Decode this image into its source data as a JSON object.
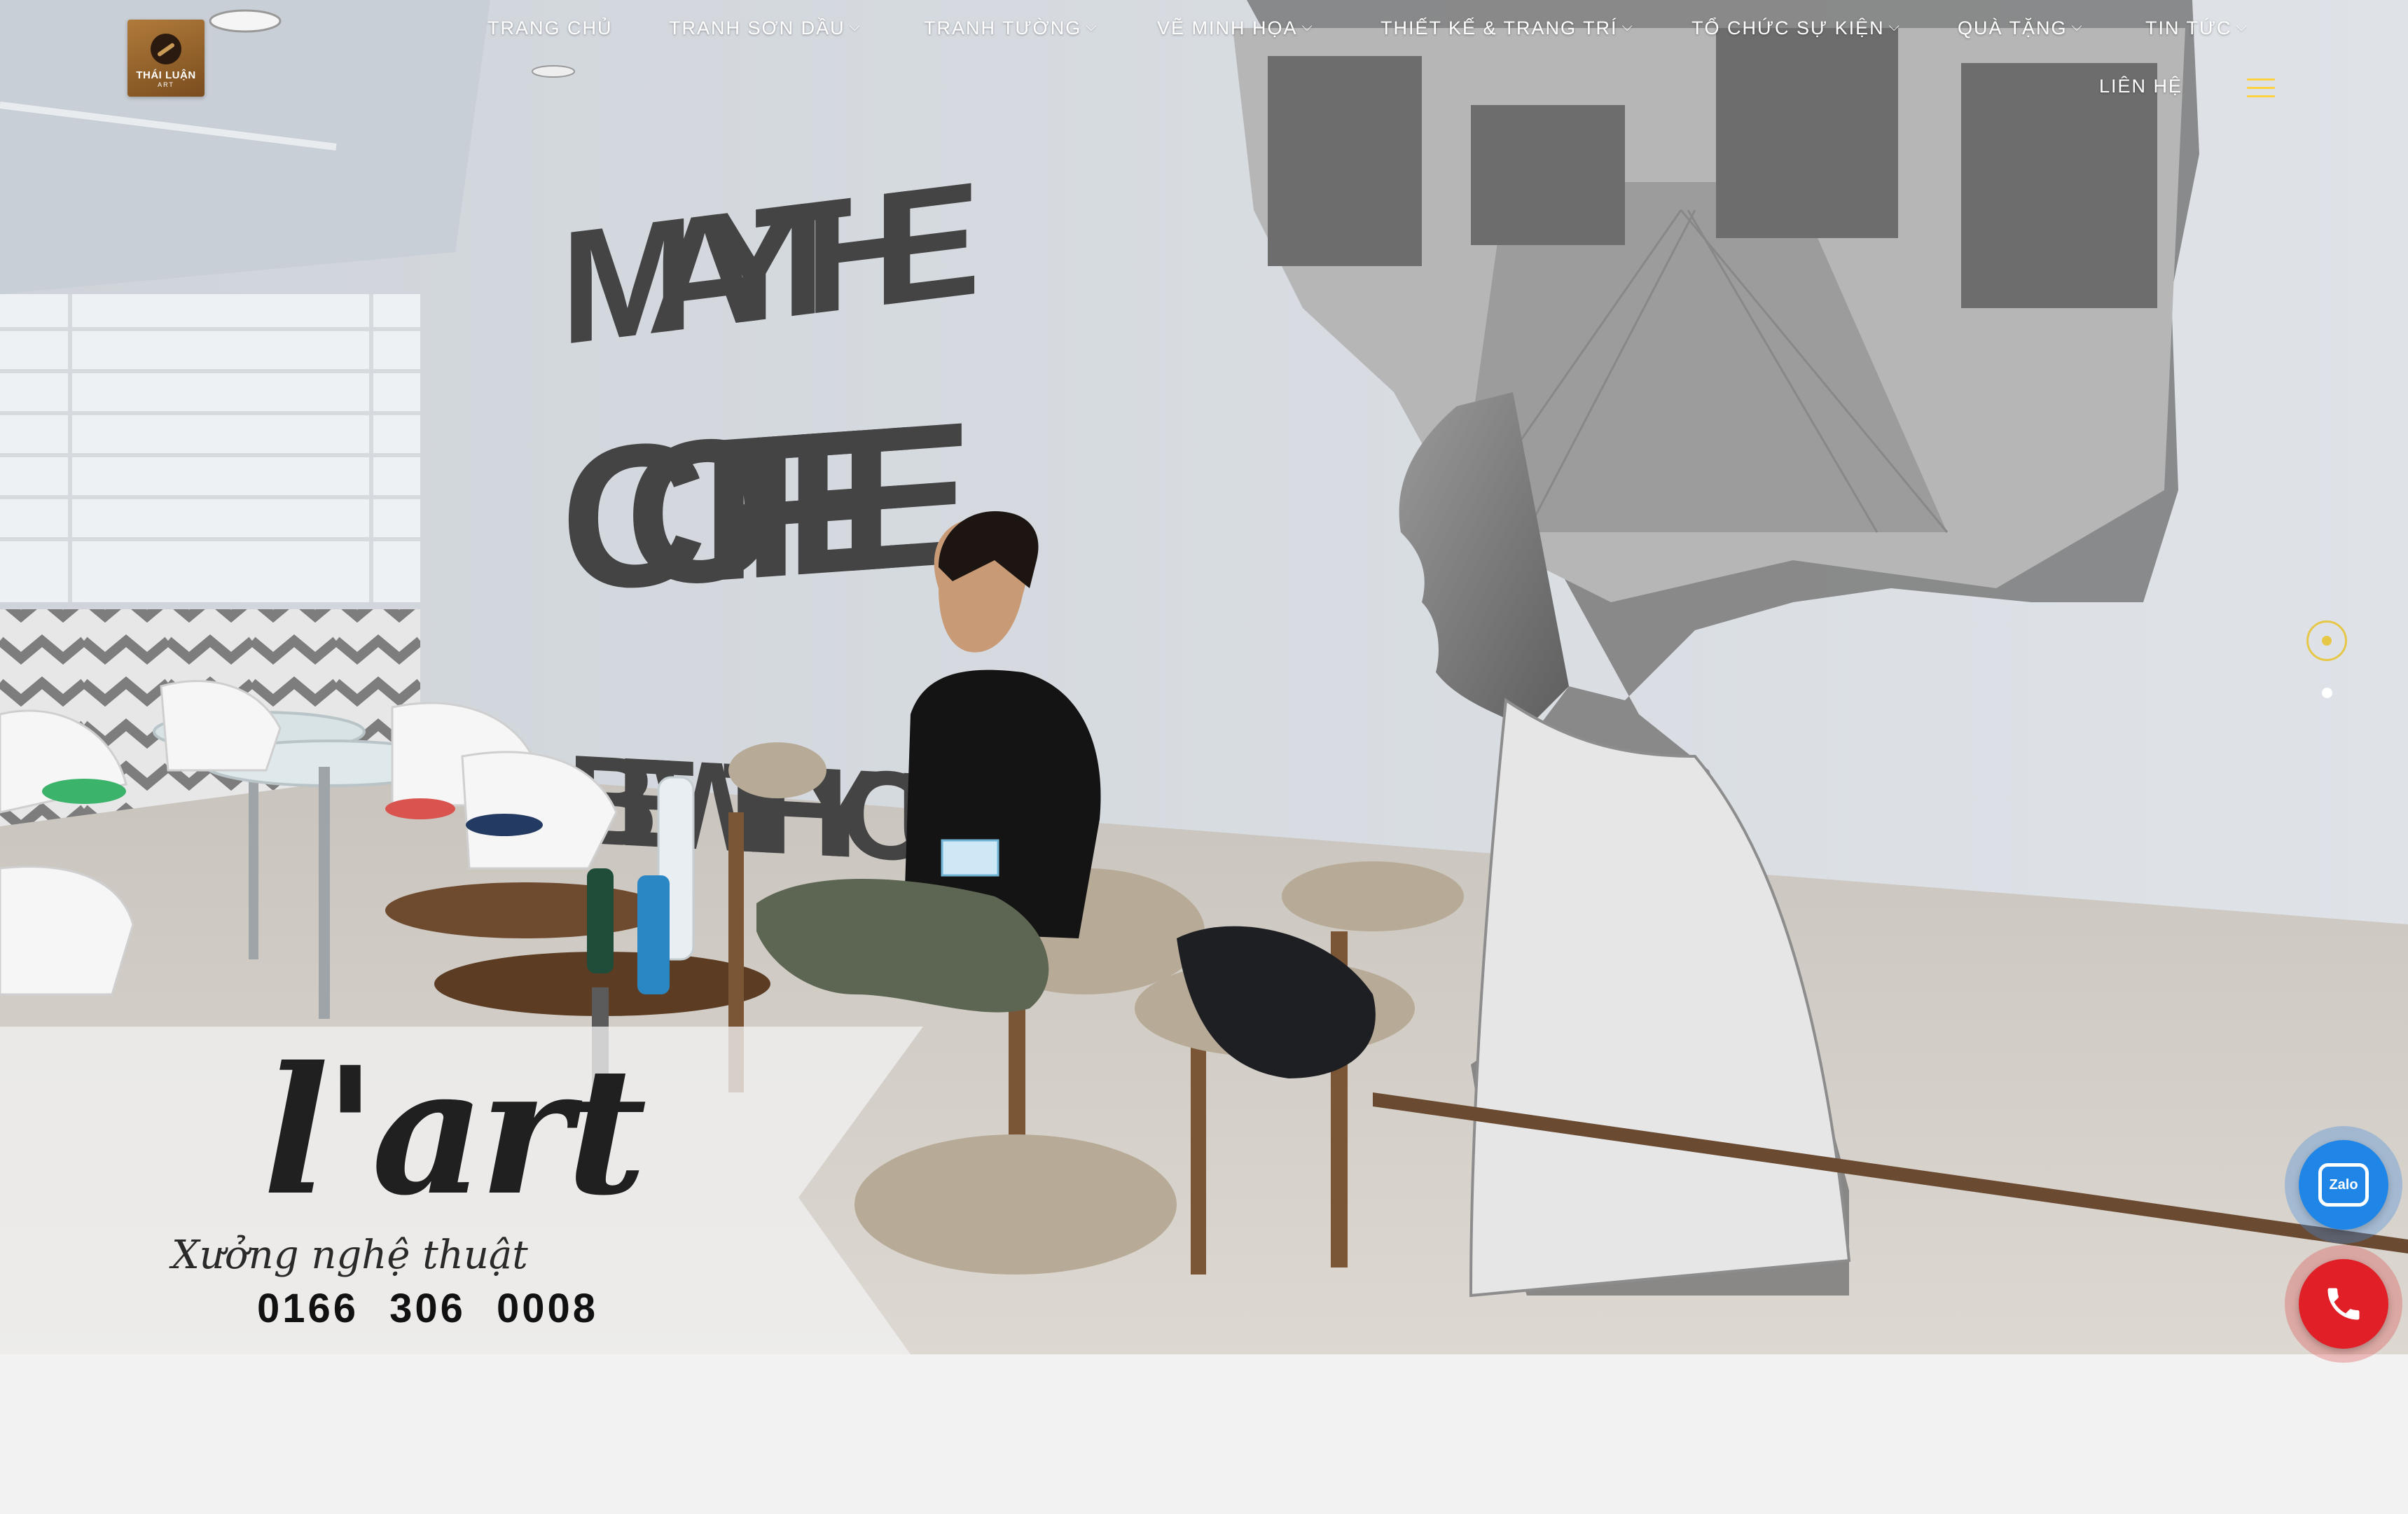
{
  "logo": {
    "line1": "THÁI LUẬN",
    "line2": "ART"
  },
  "nav": {
    "items": [
      {
        "label": "TRANG CHỦ",
        "has_dropdown": false
      },
      {
        "label": "TRANH SƠN DẦU",
        "has_dropdown": true
      },
      {
        "label": "TRANH TƯỜNG",
        "has_dropdown": true
      },
      {
        "label": "VẼ MINH HỌA",
        "has_dropdown": true
      },
      {
        "label": "THIẾT KẾ & TRANG TRÍ",
        "has_dropdown": true
      },
      {
        "label": "TỔ CHỨC SỰ KIỆN",
        "has_dropdown": true
      },
      {
        "label": "QUÀ TẶNG",
        "has_dropdown": true
      },
      {
        "label": "TIN TỨC",
        "has_dropdown": true
      }
    ],
    "contact_label": "LIÊN HỆ",
    "menu_icon": "hamburger-icon",
    "chevron": "⌵"
  },
  "hero": {
    "mural_text": [
      "MAY THE",
      "COFFEE",
      "BE WITH YOU"
    ],
    "active_slide": 1,
    "slide_count": 2
  },
  "banner": {
    "brand": "l'art",
    "subtitle": "Xưởng nghệ thuật",
    "phone": "0166 306 0008"
  },
  "floating": {
    "zalo_label": "Zalo",
    "zalo_icon": "zalo-icon",
    "phone_icon": "phone-icon"
  },
  "colors": {
    "accent": "#ffd23f",
    "dot_active": "#e7c747",
    "zalo": "#1f86e8",
    "phone": "#e11f26"
  }
}
